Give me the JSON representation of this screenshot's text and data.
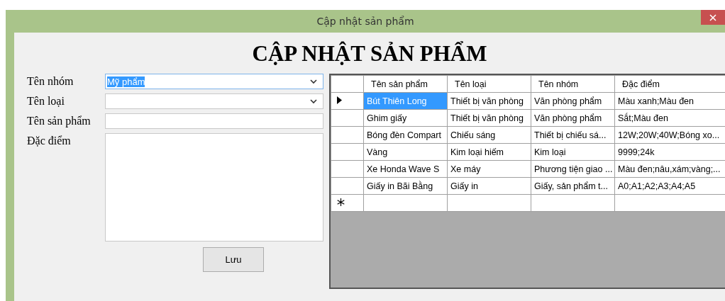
{
  "window": {
    "title": "Cập nhật sản phẩm"
  },
  "heading": "CẬP NHẬT SẢN PHẨM",
  "form": {
    "fields": [
      {
        "kind": "combo",
        "label": "Tên nhóm",
        "value": "Mỹ phẩm",
        "focused": true
      },
      {
        "kind": "combo",
        "label": "Tên loại",
        "focused": false
      },
      {
        "kind": "text",
        "label": "Tên sản phẩm",
        "focused": false
      },
      {
        "kind": "multiline",
        "label": "Đặc điểm",
        "focused": false
      }
    ],
    "save_button": "Lưu"
  },
  "table": {
    "columns": [
      "Tên sản phẩm",
      "Tên loại",
      "Tên nhóm",
      "Đặc điểm"
    ],
    "rows": [
      {
        "cells": [
          "Bút Thiên Long",
          "Thiết bị văn phòng",
          "Văn phòng phẩm",
          "Màu xanh;Màu đen"
        ],
        "selected": true
      },
      {
        "cells": [
          "Ghim giấy",
          "Thiết bị văn phòng",
          "Văn phòng phẩm",
          "Sắt;Màu đen"
        ],
        "selected": false
      },
      {
        "cells": [
          "Bóng đèn Compart",
          "Chiếu sáng",
          "Thiết bị chiếu sá...",
          "12W;20W;40W;Bóng xo..."
        ],
        "selected": false
      },
      {
        "cells": [
          "Vàng",
          "Kim loại hiếm",
          "Kim loại",
          "9999;24k"
        ],
        "selected": false
      },
      {
        "cells": [
          "Xe Honda Wave S",
          "Xe máy",
          "Phương tiện giao ...",
          "Màu đen;nâu,xám;vàng;..."
        ],
        "selected": false
      },
      {
        "cells": [
          "Giấy in Bãi Bằng",
          "Giấy in",
          "Giấy, sản phẩm t...",
          "A0;A1;A2;A3;A4;A5"
        ],
        "selected": false
      }
    ],
    "new_row": true
  }
}
